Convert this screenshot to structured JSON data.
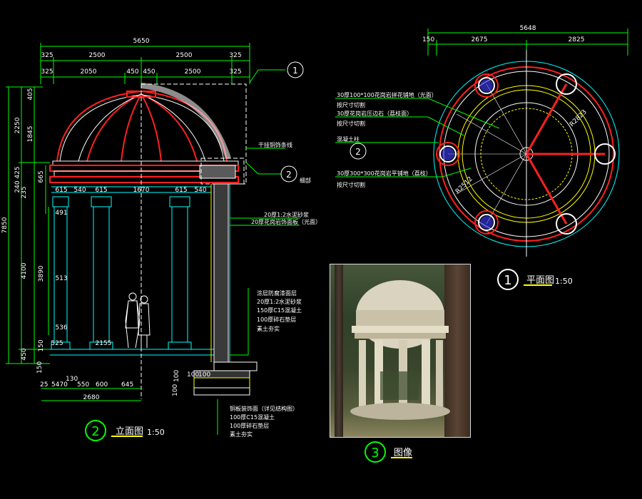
{
  "colors": {
    "bg": "#000000",
    "dim": "#00ff00",
    "cyan": "#00ffff",
    "red": "#ff2020",
    "white": "#ffffff",
    "yellow": "#ffff00",
    "magenta": "#ff40ff",
    "leader": "#00ff00"
  },
  "elevation": {
    "dim_total": "5650",
    "dim_row1": [
      "325",
      "2500",
      "2500",
      "325"
    ],
    "dim_row2": [
      "325",
      "2050",
      "450",
      "450",
      "2500",
      "325"
    ],
    "left_dims": [
      "7850",
      "2250",
      "1845",
      "405",
      "425",
      "240",
      "235",
      "665",
      "4100",
      "3890",
      "150",
      "450"
    ],
    "cornice_dims": [
      "615",
      "540",
      "615",
      "1670",
      "615",
      "540"
    ],
    "col_dims": [
      "491",
      "513",
      "536",
      "525",
      "2155"
    ],
    "bottom_dims": [
      "25",
      "5470",
      "130",
      "550",
      "600",
      "645",
      "2680"
    ],
    "base_dims": [
      "100",
      "100",
      "100",
      "150",
      "100"
    ],
    "callout_1": "1",
    "callout_2": "2",
    "label_cap": "干挂铜饰条线",
    "label_cap2": "细部",
    "notes_mid": [
      "20厚1:2水泥砂浆",
      "20厚花岗岩饰面板（光面）"
    ],
    "notes_low": [
      "涂层防腐漆面层",
      "20厚1:2水泥砂浆",
      "150厚C15混凝土",
      "100厚碎石垫层",
      "素土夯实"
    ],
    "notes_base": [
      "铜板装饰面（详见结构图）",
      "100厚C15混凝土",
      "100厚碎石垫层",
      "素土夯实"
    ],
    "title_num": "2",
    "title": "立面图",
    "scale": "1:50"
  },
  "plan": {
    "dim_total": "5648",
    "dims": [
      "150",
      "2675",
      "2825"
    ],
    "labels": [
      "30厚100*100花岗岩拼花铺地（光面）",
      "按尺寸切割",
      "30厚花岗岩压边石（荔枝面）",
      "按尺寸切割",
      "混凝土柱",
      "30厚300*300花岗岩平铺地（荔枝）",
      "按尺寸切割"
    ],
    "radius_1": "R2823",
    "radius_2": "R2512",
    "callout": "2",
    "title_num": "1",
    "title": "平面图",
    "scale": "1:50"
  },
  "photo": {
    "title_num": "3",
    "title": "图像"
  }
}
